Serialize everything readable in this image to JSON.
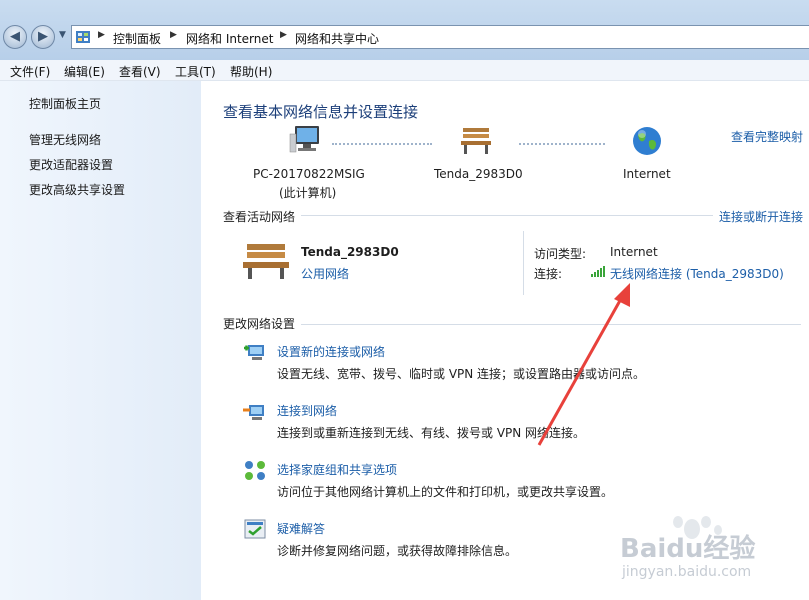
{
  "address": {
    "crumbs": [
      "控制面板",
      "网络和 Internet",
      "网络和共享中心"
    ]
  },
  "menu": [
    "文件(F)",
    "编辑(E)",
    "查看(V)",
    "工具(T)",
    "帮助(H)"
  ],
  "sidebar": {
    "home": "控制面板主页",
    "items": [
      "管理无线网络",
      "更改适配器设置",
      "更改高级共享设置"
    ]
  },
  "main": {
    "title": "查看基本网络信息并设置连接",
    "full_map": "查看完整映射",
    "map": {
      "computer_name": "PC-20170822MSIG",
      "computer_sub": "(此计算机)",
      "router": "Tenda_2983D0",
      "internet": "Internet"
    },
    "active": {
      "header": "查看活动网络",
      "connect_link": "连接或断开连接",
      "network_name": "Tenda_2983D0",
      "network_type": "公用网络",
      "access_label": "访问类型:",
      "access_value": "Internet",
      "conn_label": "连接:",
      "conn_value": "无线网络连接 (Tenda_2983D0)"
    },
    "change": {
      "header": "更改网络设置",
      "tasks": [
        {
          "title": "设置新的连接或网络",
          "desc": "设置无线、宽带、拨号、临时或 VPN 连接；或设置路由器或访问点。"
        },
        {
          "title": "连接到网络",
          "desc": "连接到或重新连接到无线、有线、拨号或 VPN 网络连接。"
        },
        {
          "title": "选择家庭组和共享选项",
          "desc": "访问位于其他网络计算机上的文件和打印机，或更改共享设置。"
        },
        {
          "title": "疑难解答",
          "desc": "诊断并修复网络问题，或获得故障排除信息。"
        }
      ]
    }
  },
  "watermark": {
    "brand": "Baidu经验",
    "url": "jingyan.baidu.com"
  },
  "colors": {
    "link": "#1c5ea8",
    "arrow": "#e8413b",
    "sidebar_bg": "#e8f0fa"
  }
}
